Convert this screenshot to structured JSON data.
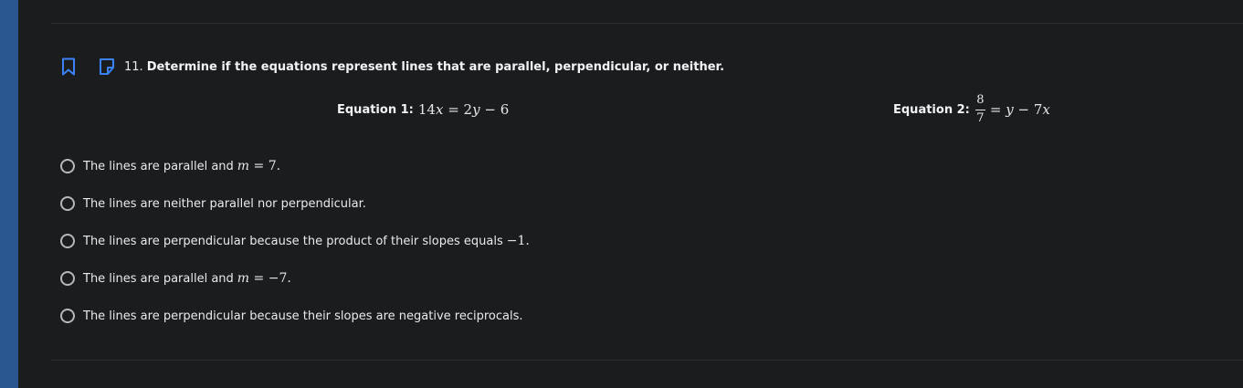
{
  "question": {
    "number": "11.",
    "prompt": "Determine if the equations represent lines that are parallel, perpendicular, or neither.",
    "bookmark_icon": "bookmark-icon",
    "note_icon": "note-icon",
    "accent_color": "#3b82f6"
  },
  "equations": {
    "eq1_label": "Equation 1:",
    "eq1_math": "14x = 2y − 6",
    "eq2_label": "Equation 2:",
    "eq2_numerator": "8",
    "eq2_denominator": "7",
    "eq2_rest": "= y − 7x"
  },
  "options": [
    {
      "text": "The lines are parallel and",
      "math": "m = 7."
    },
    {
      "text": "The lines are neither parallel nor perpendicular.",
      "math": ""
    },
    {
      "text": "The lines are perpendicular because the product of their slopes equals",
      "math": "−1."
    },
    {
      "text": "The lines are parallel and",
      "math": "m = −7."
    },
    {
      "text": "The lines are perpendicular because their slopes are negative reciprocals.",
      "math": ""
    }
  ]
}
